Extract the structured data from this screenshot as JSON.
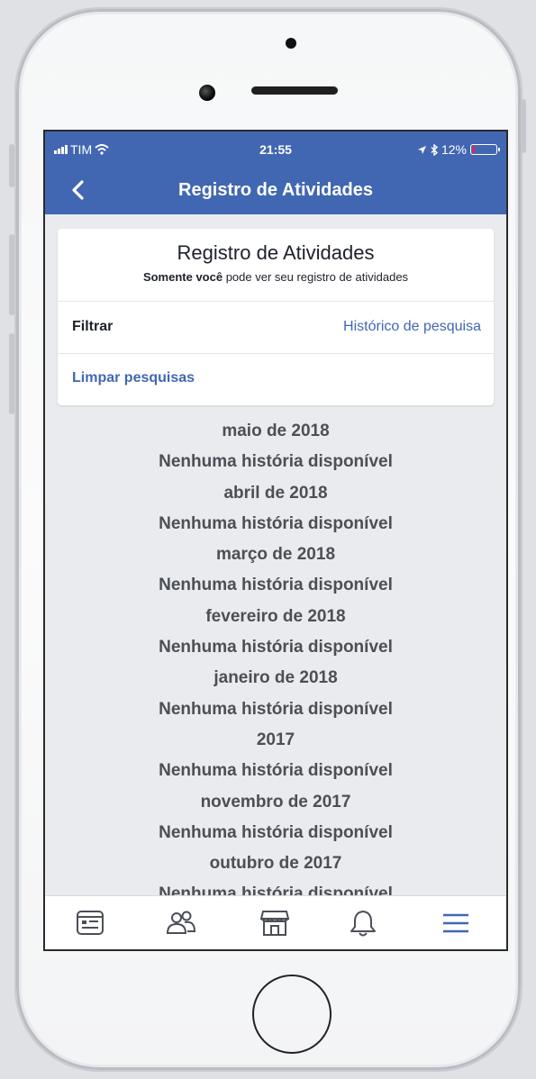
{
  "status_bar": {
    "carrier": "TIM",
    "time": "21:55",
    "battery": "12%",
    "battery_level": 0.12,
    "icons": [
      "signal-bars-icon",
      "wifi-icon",
      "location-arrow-icon",
      "bluetooth-icon",
      "battery-icon"
    ]
  },
  "nav": {
    "title": "Registro de Atividades",
    "back_icon": "chevron-left-icon"
  },
  "card": {
    "title": "Registro de Atividades",
    "subtitle_bold": "Somente você",
    "subtitle_rest": " pode ver seu registro de atividades",
    "filter_label": "Filtrar",
    "filter_value": "Histórico de pesquisa",
    "clear_label": "Limpar pesquisas"
  },
  "history": [
    {
      "period": "maio de 2018",
      "message": "Nenhuma história disponível"
    },
    {
      "period": "abril de 2018",
      "message": "Nenhuma história disponível"
    },
    {
      "period": "março de 2018",
      "message": "Nenhuma história disponível"
    },
    {
      "period": "fevereiro de 2018",
      "message": "Nenhuma história disponível"
    },
    {
      "period": "janeiro de 2018",
      "message": "Nenhuma história disponível"
    },
    {
      "period": "2017",
      "message": "Nenhuma história disponível"
    },
    {
      "period": "novembro de 2017",
      "message": "Nenhuma história disponível"
    },
    {
      "period": "outubro de 2017",
      "message": "Nenhuma história disponível"
    }
  ],
  "tab_bar": {
    "icons": [
      "news-feed-icon",
      "friends-icon",
      "marketplace-icon",
      "notifications-bell-icon",
      "menu-hamburger-icon"
    ],
    "active_index": 4,
    "active_color": "#4267b2",
    "inactive_color": "#4b4f56"
  },
  "colors": {
    "brand": "#4267b2",
    "background": "#e9ebee",
    "text_dark": "#1d2129",
    "text_muted": "#4b4f56",
    "battery_low": "#e0245e"
  }
}
